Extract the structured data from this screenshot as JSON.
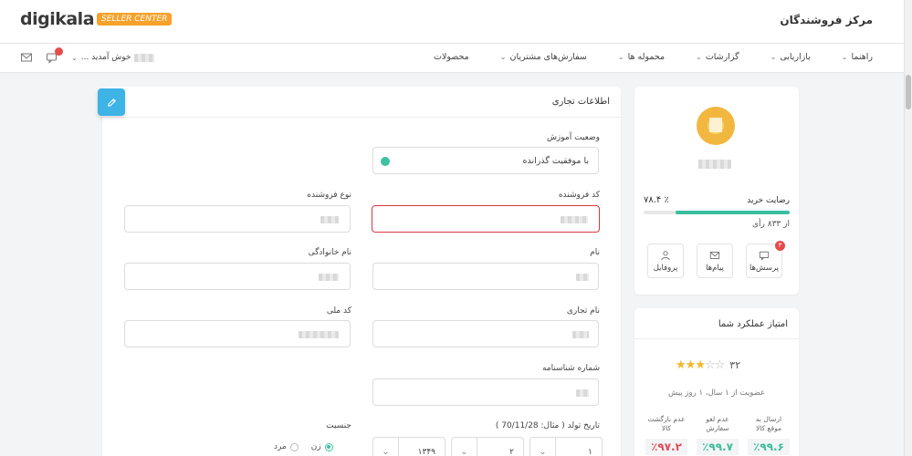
{
  "header": {
    "logo_text": "digikala",
    "logo_badge": "SELLER CENTER",
    "app_title": "مرکز فروشندگان"
  },
  "nav": {
    "items": [
      {
        "label": "محصولات"
      },
      {
        "label": "سفارش‌های مشتریان"
      },
      {
        "label": "محموله ها"
      },
      {
        "label": "گزارشات"
      },
      {
        "label": "بازاریابی"
      },
      {
        "label": "راهنما"
      }
    ],
    "welcome": "خوش آمدید ...",
    "notif_count": "۳"
  },
  "profile": {
    "satisfaction_label": "رضایت خرید",
    "satisfaction_value": "٪ ۷۸.۴",
    "satisfaction_percent": 78.4,
    "votes": "از ۸۳۳ رأی",
    "actions": [
      {
        "label": "پرسش‌ها",
        "badge": "۳"
      },
      {
        "label": "پیام‌ها"
      },
      {
        "label": "پروفایل"
      }
    ]
  },
  "score": {
    "title": "امتیاز عملکرد شما",
    "value": "۳۲",
    "stars_filled": 3,
    "stars_total": 5,
    "member_since": "عضویت از ۱ سال، ۱ روز پیش",
    "metrics": [
      {
        "label": "ارسال به موقع کالا",
        "value": "٪۹۹.۶",
        "color": "#3cbf9a"
      },
      {
        "label": "عدم لغو سفارش",
        "value": "٪۹۹.۷",
        "color": "#3cbf9a"
      },
      {
        "label": "عدم بازگشت کالا",
        "value": "٪۹۷.۲",
        "color": "#e34d5a"
      }
    ]
  },
  "form": {
    "title": "اطلاعات تجاری",
    "training_status_label": "وضعیت آموزش",
    "training_status_value": "با موفقیت گذرانده",
    "seller_code_label": "کد فروشنده",
    "seller_type_label": "نوع فروشنده",
    "first_name_label": "نام",
    "last_name_label": "نام خانوادگی",
    "business_name_label": "نام تجاری",
    "national_code_label": "کد ملی",
    "id_number_label": "شماره شناسنامه",
    "birthdate_label": "تاریخ تولد ( مثال: 70/11/28 )",
    "birth_day": "۱",
    "birth_month": "۲",
    "birth_year": "۱۳۴۹",
    "gender_label": "جنسیت",
    "gender_female": "زن",
    "gender_male": "مرد"
  }
}
